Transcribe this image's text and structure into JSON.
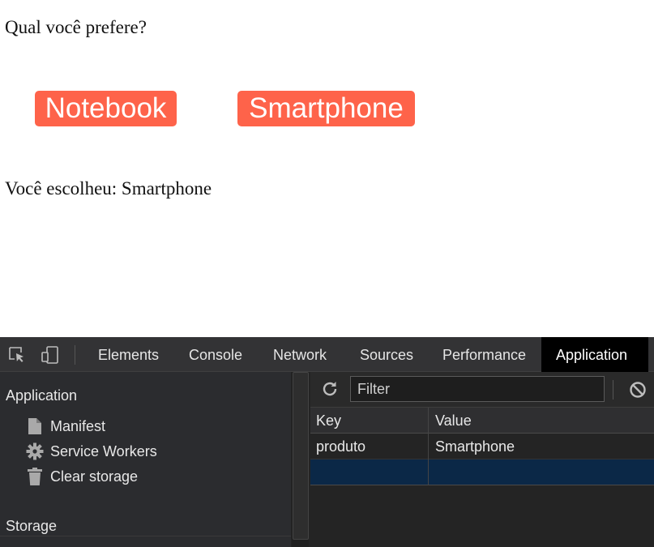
{
  "page": {
    "question": "Qual você prefere?",
    "buttons": [
      {
        "label": "Notebook"
      },
      {
        "label": "Smartphone"
      }
    ],
    "result": "Você escolheu: Smartphone",
    "accent_color": "#fe634a"
  },
  "devtools": {
    "tabs": [
      {
        "label": "Elements",
        "active": false
      },
      {
        "label": "Console",
        "active": false
      },
      {
        "label": "Network",
        "active": false
      },
      {
        "label": "Sources",
        "active": false
      },
      {
        "label": "Performance",
        "active": false
      },
      {
        "label": "Application",
        "active": true
      }
    ],
    "toolbar_icons": [
      "inspect-element-icon",
      "device-toolbar-icon"
    ],
    "sidebar": {
      "section_application": "Application",
      "items": [
        {
          "label": "Manifest",
          "icon": "document-icon"
        },
        {
          "label": "Service Workers",
          "icon": "gear-icon"
        },
        {
          "label": "Clear storage",
          "icon": "trash-icon"
        }
      ],
      "section_storage": "Storage"
    },
    "storage_view": {
      "filter_placeholder": "Filter",
      "filter_value": "",
      "columns": {
        "key": "Key",
        "value": "Value"
      },
      "rows": [
        {
          "key": "produto",
          "value": "Smartphone"
        },
        {
          "key": "",
          "value": ""
        }
      ],
      "selected_row_color": "#0b2847"
    }
  }
}
